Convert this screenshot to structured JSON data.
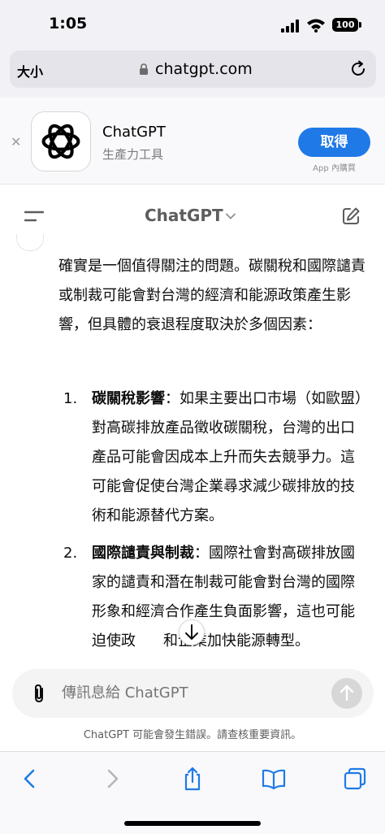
{
  "status": {
    "time": "1:05",
    "battery": "100"
  },
  "safari": {
    "text_size": "大小",
    "url": "chatgpt.com"
  },
  "banner": {
    "app_name": "ChatGPT",
    "app_subtitle": "生產力工具",
    "get_label": "取得",
    "iap_label": "App 內購買"
  },
  "chat": {
    "title": "ChatGPT"
  },
  "message": {
    "intro": "確實是一個值得關注的問題。碳關稅和國際譴責或制裁可能會對台灣的經濟和能源政策產生影響，但具體的衰退程度取決於多個因素：",
    "items": [
      {
        "num": "1.",
        "heading": "碳關稅影響",
        "body": "：如果主要出口市場（如歐盟）對高碳排放產品徵收碳關稅，台灣的出口產品可能會因成本上升而失去競爭力。這可能會促使台灣企業尋求減少碳排放的技術和能源替代方案。"
      },
      {
        "num": "2.",
        "heading": "國際譴責與制裁",
        "body": "：國際社會對高碳排放國家的譴責和潛在制裁可能會對台灣的國際形象和經濟合作產生負面影響，這也可能迫使政",
        "body_after_button": "和企業加快能源轉型。"
      }
    ]
  },
  "composer": {
    "placeholder": "傳訊息給 ChatGPT"
  },
  "disclaimer": "ChatGPT 可能會發生錯誤。請查核重要資訊。",
  "colors": {
    "accent_blue": "#1f7ae7",
    "text": "#0d0d0d",
    "muted": "#8f8f8f"
  },
  "icons": [
    "signal-icon",
    "wifi-icon",
    "lock-icon",
    "reload-icon",
    "close-icon",
    "openai-logo-icon",
    "menu-icon",
    "chevron-down-icon",
    "edit-icon",
    "arrow-down-icon",
    "paperclip-icon",
    "arrow-up-icon",
    "back-icon",
    "forward-icon",
    "share-icon",
    "bookmarks-icon",
    "tabs-icon"
  ]
}
